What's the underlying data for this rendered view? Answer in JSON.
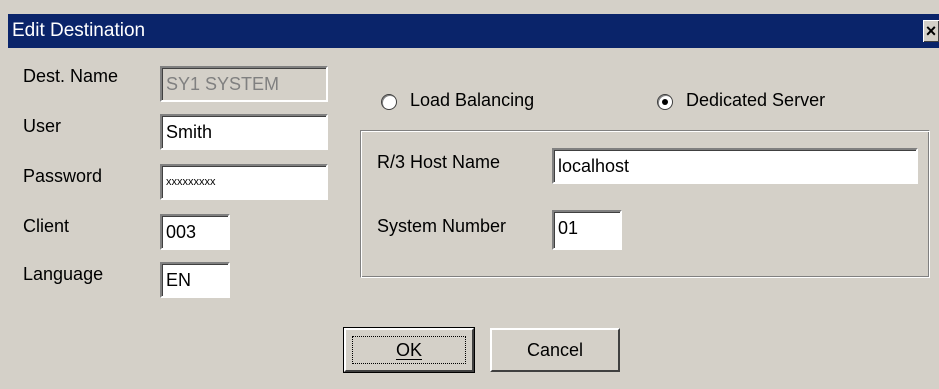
{
  "window": {
    "title": "Edit Destination",
    "close_glyph": "×"
  },
  "form": {
    "dest_name_label": "Dest. Name",
    "dest_name_value": "SY1 SYSTEM",
    "user_label": "User",
    "user_value": "Smith",
    "password_label": "Password",
    "password_value": "xxxxxxxxx",
    "client_label": "Client",
    "client_value": "003",
    "language_label": "Language",
    "language_value": "EN"
  },
  "connection": {
    "load_balancing_label": "Load Balancing",
    "dedicated_server_label": "Dedicated Server",
    "selected": "dedicated_server",
    "host_label": "R/3 Host Name",
    "host_value": "localhost",
    "sysnum_label": "System Number",
    "sysnum_value": "01"
  },
  "buttons": {
    "ok_label": "OK",
    "cancel_label": "Cancel"
  },
  "colors": {
    "titlebar": "#0a246a",
    "dialog_bg": "#d4d0c8",
    "field_bg": "#ffffff",
    "disabled_text": "#808080"
  }
}
